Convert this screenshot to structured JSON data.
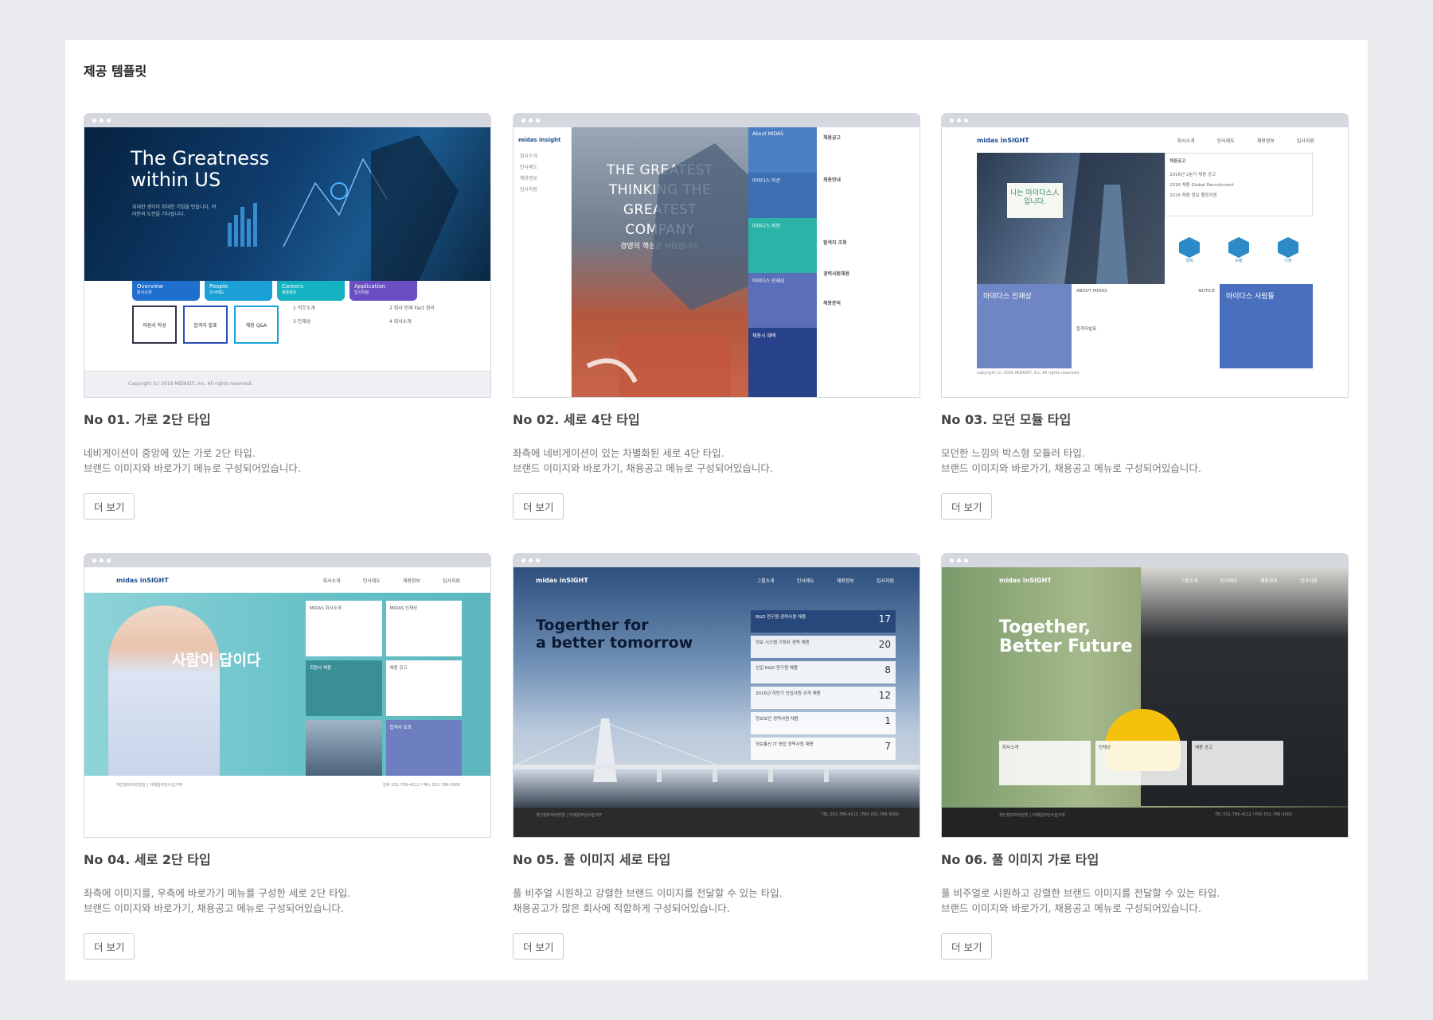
{
  "section_title": "제공 템플릿",
  "cards": [
    {
      "title": "No 01. 가로 2단 타입",
      "desc1": "네비게이션이 중앙에 있는 가로 2단 타입.",
      "desc2": "브랜드 이미지와 바로가기 메뉴로 구성되어있습니다.",
      "button": "더 보기"
    },
    {
      "title": "No 02. 세로 4단 타입",
      "desc1": "좌측에 네비게이션이 있는 차별화된 세로 4단 타입.",
      "desc2": "브랜드 이미지와 바로가기, 채용공고 메뉴로 구성되어있습니다.",
      "button": "더 보기"
    },
    {
      "title": "No 03. 모던 모듈 타입",
      "desc1": "모던한 느낌의 박스형 모듈러 타입.",
      "desc2": "브랜드 이미지와 바로가기, 채용공고 메뉴로 구성되어있습니다.",
      "button": "더 보기"
    },
    {
      "title": "No 04. 세로 2단 타입",
      "desc1": "좌측에 이미지를, 우측에 바로가기 메뉴를 구성한 세로 2단 타입.",
      "desc2": "브랜드 이미지와 바로가기, 채용공고 메뉴로 구성되어있습니다.",
      "button": "더 보기"
    },
    {
      "title": "No 05. 풀 이미지 세로 타입",
      "desc1": "풀 비주얼 시원하고 강렬한 브랜드 이미지를 전달할 수 있는 타입.",
      "desc2": "채용공고가 많은 회사에 적합하게 구성되어있습니다.",
      "button": "더 보기"
    },
    {
      "title": "No 06. 풀 이미지 가로 타입",
      "desc1": "풀 비주얼로 시원하고 강렬한 브랜드 이미지를 전달할 수 있는 타입.",
      "desc2": "브랜드 이미지와 바로가기, 채용공고 메뉴로 구성되어있습니다.",
      "button": "더 보기"
    }
  ],
  "previews": {
    "t1": {
      "hero_title_1": "The Greatness",
      "hero_title_2": "within US",
      "hero_sub": "위대한 생각이 위대한 기업을 만듭니다. 여러분의 도전을 기다립니다.",
      "tabs": [
        {
          "label": "Overview",
          "sub": "회사소개",
          "color": "#1f6fcf"
        },
        {
          "label": "People",
          "sub": "인사제도",
          "color": "#1a9fd6"
        },
        {
          "label": "Careers",
          "sub": "채용정보",
          "color": "#14b3c2"
        },
        {
          "label": "Application",
          "sub": "입사지원",
          "color": "#6a4fc2"
        }
      ],
      "icons": [
        "의원서 작성",
        "합격자 발표",
        "채용 Q&A"
      ],
      "list": [
        "1 직무소개",
        "2 회사 인재 Fact 정리",
        "3 인재상",
        "4 회사소개"
      ],
      "foot": "Copyright (c) 2016 MIDASIT, Inc. All rights reserved."
    },
    "t2": {
      "logo": "midas insight",
      "menu": [
        "회사소개",
        "인사제도",
        "채용정보",
        "입사지원"
      ],
      "hero": "THE GREATEST THINKING THE GREATEST COMPANY",
      "hero_sub": "경영의 핵심은 사람입니다.",
      "blocks": [
        {
          "label": "About MIDAS",
          "color": "#4a7fc1"
        },
        {
          "label": "마이다스 미션",
          "color": "#4a7fc1"
        },
        {
          "label": "마이다스 비전",
          "color": "#2bb3a8"
        },
        {
          "label": "마이다스 인재상",
          "color": "#5a6fb8"
        },
        {
          "label": "채용시 혜택",
          "color": "#27418a"
        }
      ],
      "right": [
        "채용공고",
        "채용안내",
        "합격자 조회",
        "경력사원채용",
        "채용문의"
      ]
    },
    "t3": {
      "logo": "midas inSIGHT",
      "nav": [
        "회사소개",
        "인사제도",
        "채용정보",
        "입사지원"
      ],
      "card": "나는 마이다스人 입니다.",
      "notice": "채용공고",
      "notice_items": [
        "2016년 2분기 채용 공고",
        "2016 채용 Global Recruitment",
        "2016 채용 정보 행정지원"
      ],
      "icons": [
        "행복",
        "보람",
        "나눔"
      ],
      "blue1": "마이다스 인재상",
      "mid": [
        "ABOUT MIDAS",
        "NOTICE",
        "합격자발표"
      ],
      "blue2": "마이다스 사람들",
      "foot": "copyright (c) 2016 MIDASIT, Inc. All rights reserved."
    },
    "t4": {
      "logo": "midas inSIGHT",
      "nav": [
        "회사소개",
        "인사제도",
        "채용정보",
        "입사지원"
      ],
      "hero": "사람이 답이다",
      "boxes": [
        "MIDAS 회사소개",
        "MIDAS 인재상",
        "회원사 채용",
        "채용 공고",
        "",
        "합격자 조회",
        "",
        "채용 문의"
      ],
      "foot_left": "개인정보처리방침 | 이메일무단수집거부",
      "foot_right": "전화 031-789-4112 / 팩스 031-789-3000"
    },
    "t5": {
      "logo": "midas inSIGHT",
      "nav": [
        "그룹소개",
        "인사제도",
        "채용정보",
        "입사지원"
      ],
      "title_1": "Togerther for",
      "title_2": "a better tomorrow",
      "rows": [
        {
          "text": "R&D 연구원 경력사원 채용",
          "n": "17"
        },
        {
          "text": "정보 시스템 기획자 경력 채용",
          "n": "20"
        },
        {
          "text": "신입 R&D 연구원 채용",
          "n": "8"
        },
        {
          "text": "2016년 하반기 신입사원 공개 채용",
          "n": "12"
        },
        {
          "text": "정보보안 경력사원 채용",
          "n": "1"
        },
        {
          "text": "정보통신 IT 영업 경력사원 채용",
          "n": "7"
        }
      ],
      "foot_left": "개인정보처리방침 | 이메일무단수집거부",
      "foot_right": "TEL 031-789-4112 / FAX 031-789-3000"
    },
    "t6": {
      "logo": "midas inSIGHT",
      "nav": [
        "그룹소개",
        "인사제도",
        "채용정보",
        "입사지원"
      ],
      "title_1": "Together,",
      "title_2": "Better Future",
      "boxes": [
        "회사소개",
        "인재상",
        "채용 공고"
      ],
      "foot_left": "개인정보처리방침 | 이메일무단수집거부",
      "foot_right": "TEL 031-789-4112 / FAX 031-789-3000"
    }
  }
}
